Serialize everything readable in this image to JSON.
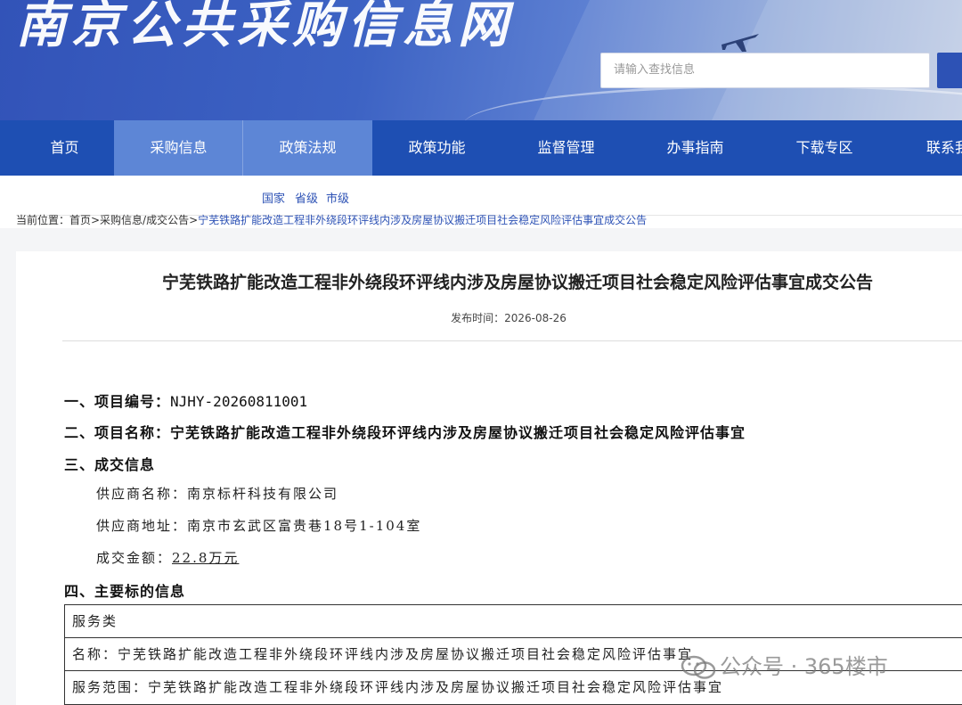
{
  "header": {
    "site_name": "南京公共采购信息网",
    "search_placeholder": "请输入查找信息"
  },
  "nav": {
    "items": [
      {
        "label": "首页"
      },
      {
        "label": "采购信息",
        "active": true
      },
      {
        "label": "政策法规",
        "active": true
      },
      {
        "label": "政策功能"
      },
      {
        "label": "监督管理"
      },
      {
        "label": "办事指南"
      },
      {
        "label": "下载专区"
      },
      {
        "label": "联系我"
      }
    ]
  },
  "subnav": {
    "links": [
      "国家",
      "省级",
      "市级"
    ]
  },
  "breadcrumb": {
    "prefix": "当前位置：首页>采购信息/成交公告>",
    "current": "宁芜铁路扩能改造工程非外绕段环评线内涉及房屋协议搬迁项目社会稳定风险评估事宜成交公告"
  },
  "article": {
    "title": "宁芜铁路扩能改造工程非外绕段环评线内涉及房屋协议搬迁项目社会稳定风险评估事宜成交公告",
    "publish_time": "发布时间：2026-08-26",
    "s1_label": "一、项目编号：",
    "s1_value": "NJHY-20260811001",
    "s2_label": "二、项目名称：",
    "s2_value": "宁芜铁路扩能改造工程非外绕段环评线内涉及房屋协议搬迁项目社会稳定风险评估事宜",
    "s3_label": "三、成交信息",
    "supplier_name": "供应商名称：南京标杆科技有限公司",
    "supplier_address": "供应商地址：南京市玄武区富贵巷18号1-104室",
    "amount_label": "成交金额：",
    "amount_value": "22.8万元",
    "s4_label": "四、主要标的信息",
    "table": {
      "row1": "服务类",
      "row2": "名称：宁芜铁路扩能改造工程非外绕段环评线内涉及房屋协议搬迁项目社会稳定风险评估事宜",
      "row3": "服务范围：宁芜铁路扩能改造工程非外绕段环评线内涉及房屋协议搬迁项目社会稳定风险评估事宜"
    }
  },
  "watermark": {
    "text": "公众号 · 365楼市"
  }
}
